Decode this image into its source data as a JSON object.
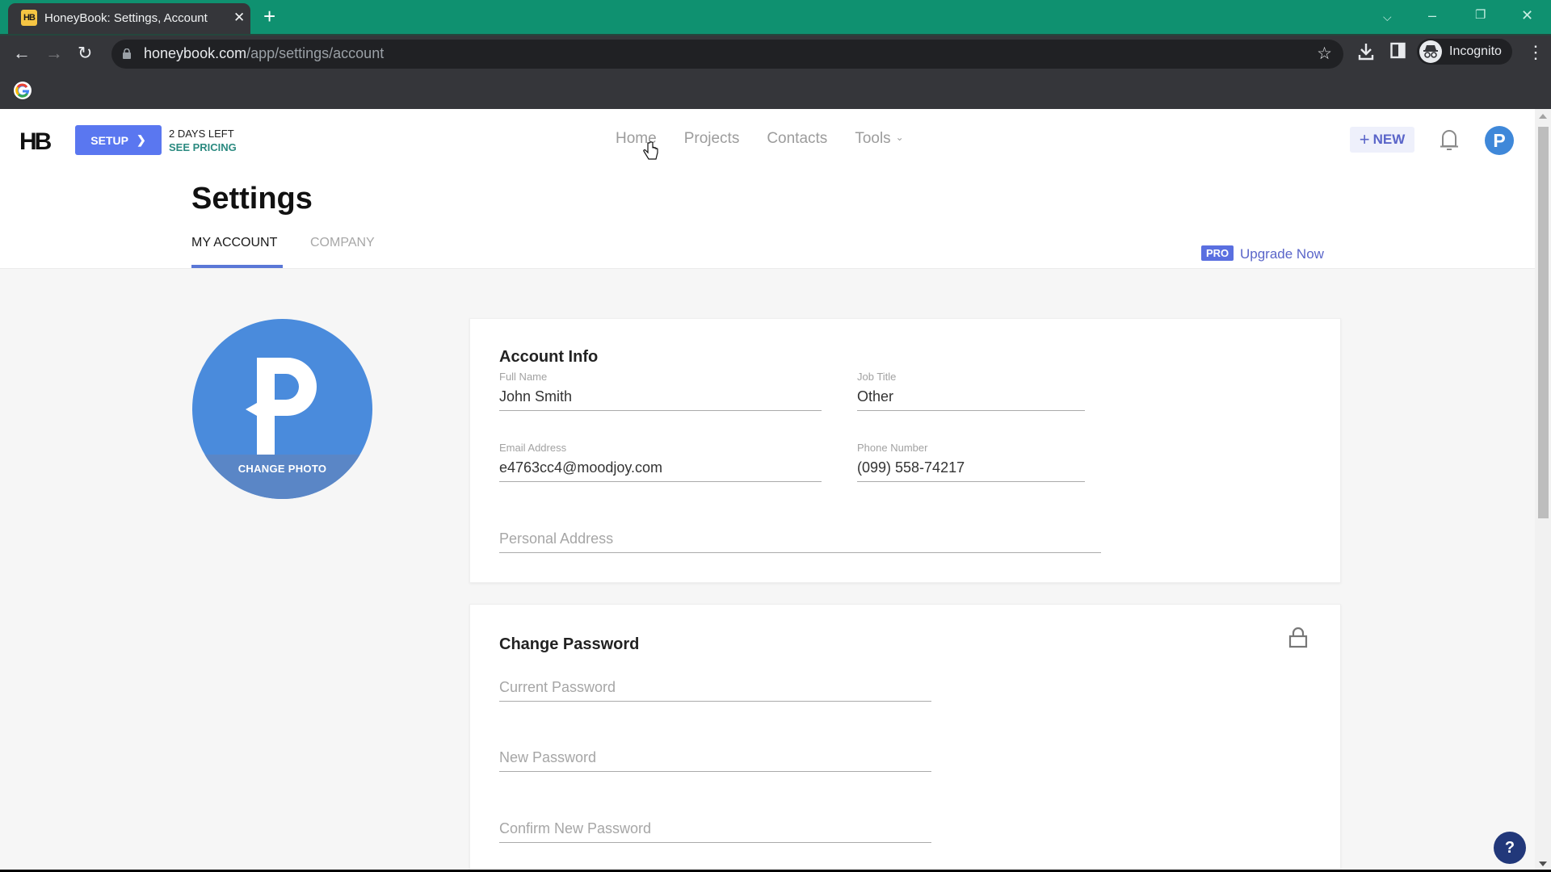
{
  "browser": {
    "tab_title": "HoneyBook: Settings, Account",
    "favicon_text": "HB",
    "url_host": "honeybook.com",
    "url_path": "/app/settings/account",
    "profile_label": "Incognito",
    "colors": {
      "tabstrip": "#0f9170",
      "toolbar": "#35363a"
    }
  },
  "header": {
    "logo": "HB",
    "setup_label": "SETUP",
    "trial_text": "2 DAYS LEFT",
    "pricing_link": "SEE PRICING",
    "nav": [
      {
        "label": "Home"
      },
      {
        "label": "Projects"
      },
      {
        "label": "Contacts"
      },
      {
        "label": "Tools"
      }
    ],
    "new_button": "NEW",
    "user_initial": "P"
  },
  "settings": {
    "title": "Settings",
    "tabs": [
      {
        "label": "MY ACCOUNT",
        "active": true
      },
      {
        "label": "COMPANY",
        "active": false
      }
    ],
    "pro_badge": "PRO",
    "upgrade_link": "Upgrade Now"
  },
  "profile_photo": {
    "initial": "P",
    "change_label": "CHANGE PHOTO"
  },
  "account_info": {
    "title": "Account Info",
    "full_name": {
      "label": "Full Name",
      "value": "John Smith"
    },
    "job_title": {
      "label": "Job Title",
      "value": "Other"
    },
    "email": {
      "label": "Email Address",
      "value": "e4763cc4@moodjoy.com"
    },
    "phone": {
      "label": "Phone Number",
      "value": "(099) 558-74217"
    },
    "address": {
      "placeholder": "Personal Address",
      "value": ""
    }
  },
  "change_password": {
    "title": "Change Password",
    "current": {
      "placeholder": "Current Password"
    },
    "new": {
      "placeholder": "New Password"
    },
    "confirm": {
      "placeholder": "Confirm New Password"
    }
  },
  "help": {
    "label": "?"
  },
  "accent_color": "#5a77f0"
}
